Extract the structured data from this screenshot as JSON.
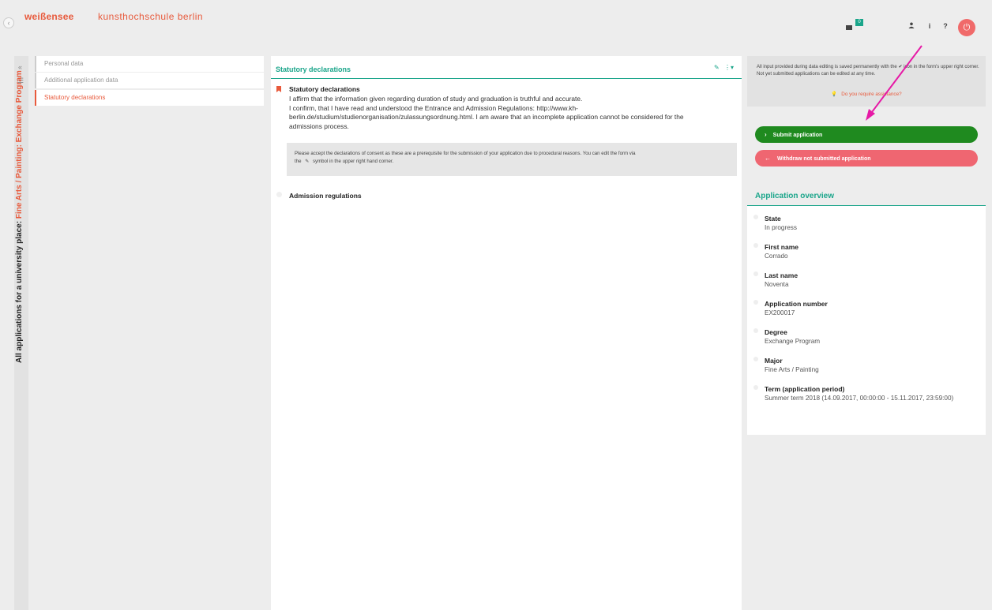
{
  "header": {
    "back_icon": "‹",
    "logo_part1": "weißensee",
    "logo_part2": "kunsthochschule berlin",
    "cart_badge": "0",
    "icons": [
      "user-icon",
      "info-icon",
      "help-icon",
      "power-icon"
    ]
  },
  "sidebar": {
    "vertical_title_prefix": "All applications for a university place: ",
    "vertical_title_accent": "Fine Arts / Painting: Exchange Program",
    "items": [
      {
        "label": "Personal data",
        "active": false
      },
      {
        "label": "Additional application data",
        "active": false
      },
      {
        "label": "Statutory declarations",
        "active": true
      }
    ]
  },
  "main": {
    "title": "Statutory declarations",
    "section_heading": "Statutory declarations",
    "line1": "I affirm that the information given regarding duration of study and graduation is truthful and accurate.",
    "line2": "I confirm, that I have read and understood the Entrance and Admission Regulations: http://www.kh-",
    "line3": "berlin.de/studium/studienorganisation/zulassungsordnung.html. I am aware that an incomplete application cannot be considered for the",
    "line4": "admissions process.",
    "notice1": "Please accept the declarations of consent as these are a prerequisite for the submission of your application due to procedural reasons. You can edit the form via",
    "notice2": "symbol in the upper right hand corner.",
    "notice2_prefix": "the",
    "admission_heading": "Admission regulations"
  },
  "right": {
    "info_text": "All input provided during data editing is saved permanently with the ✔ icon in the form's upper right corner. Not yet submitted applications can be edited at any time.",
    "assist_link": "Do you require assistance?",
    "submit_label": "Submit application",
    "withdraw_label": "Withdraw not submitted application",
    "overview_title": "Application overview",
    "overview": [
      {
        "label": "State",
        "value": "In progress"
      },
      {
        "label": "First name",
        "value": "Corrado"
      },
      {
        "label": "Last name",
        "value": "Noventa"
      },
      {
        "label": "Application number",
        "value": "EX200017"
      },
      {
        "label": "Degree",
        "value": "Exchange Program"
      },
      {
        "label": "Major",
        "value": "Fine Arts / Painting"
      },
      {
        "label": "Term (application period)",
        "value": "Summer term 2018 (14.09.2017, 00:00:00 - 15.11.2017, 23:59:00)"
      }
    ]
  },
  "colors": {
    "accent": "#e85a3c",
    "teal": "#1aa58a",
    "submit": "#1f8a1f",
    "withdraw": "#ef6671",
    "annotation": "#e619a6"
  }
}
